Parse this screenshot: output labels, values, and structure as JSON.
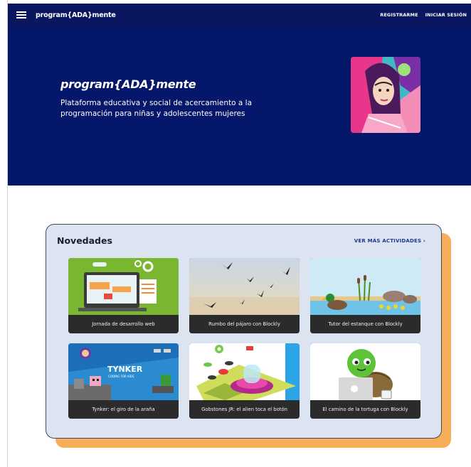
{
  "navbar": {
    "brand": "program{ADA}mente",
    "register": "REGISTRARME",
    "login": "INICIAR SESIÓN"
  },
  "hero": {
    "title": "program{ADA}mente",
    "subtitle": "Plataforma educativa y social de acercamiento a la programación para niñas y adolescentes mujeres"
  },
  "novedades": {
    "title": "Novedades",
    "see_more": "VER MÁS ACTIVIDADES ›",
    "activities": [
      {
        "label": "Jornada de desarrollo web",
        "icon": "web-dev-illustration"
      },
      {
        "label": "Rumbo del pájaro con Blockly",
        "icon": "birds-flying-illustration"
      },
      {
        "label": "Tutor del estanque con Blockly",
        "icon": "duck-pond-illustration"
      },
      {
        "label": "Tynker: el giro de la araña",
        "icon": "tynker-illustration"
      },
      {
        "label": "Gobstones JR: el alien toca el botón",
        "icon": "alien-button-illustration"
      },
      {
        "label": "El camino de la tortuga con Blockly",
        "icon": "turtle-laptop-illustration"
      }
    ]
  },
  "colors": {
    "nav_bg": "#0a1760",
    "hero_bg": "#04176b",
    "card_bg": "#dce3f1",
    "card_shadow": "#f6ae5a",
    "link": "#1d3a8f"
  }
}
